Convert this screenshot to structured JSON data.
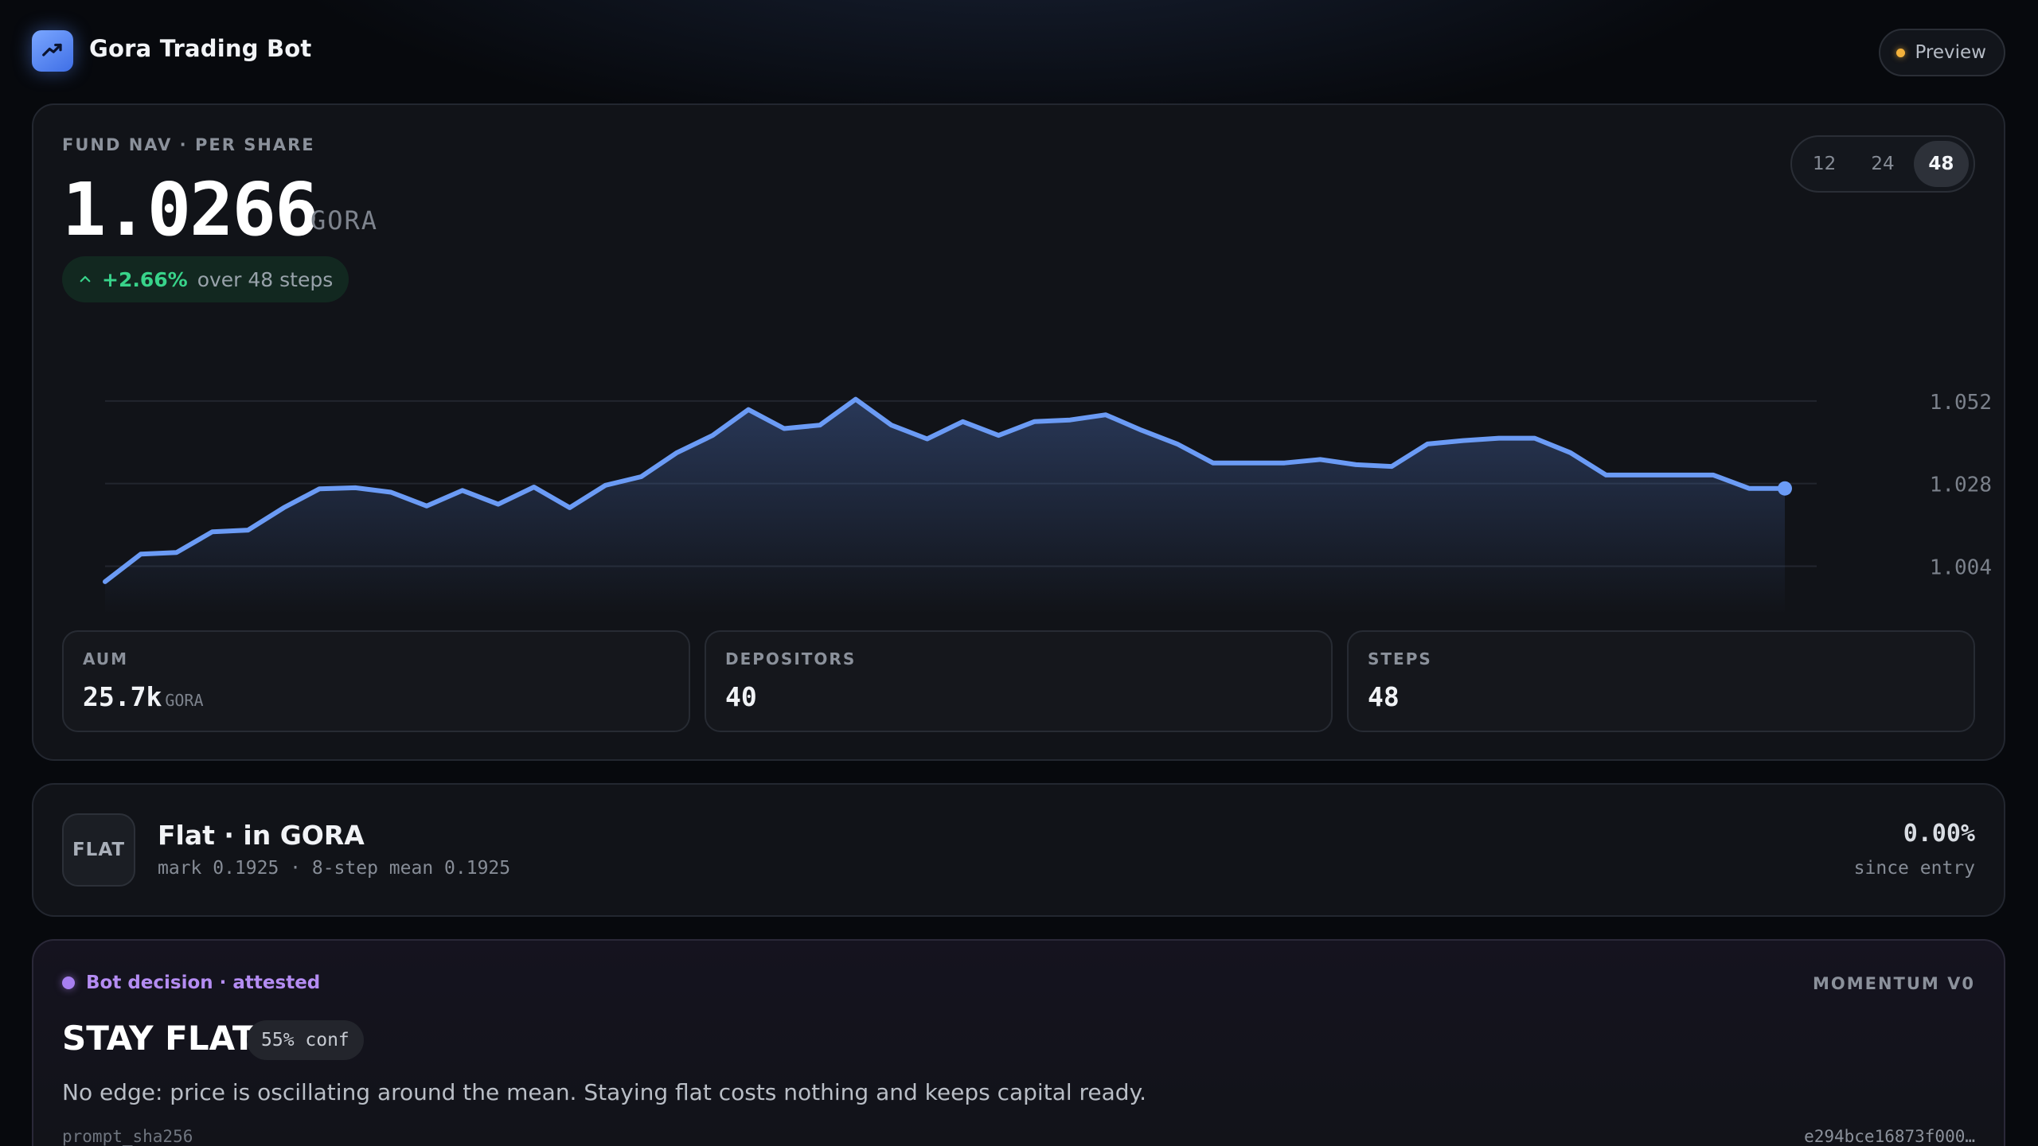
{
  "app": {
    "title": "Gora Trading Bot",
    "preview_label": "Preview"
  },
  "nav": {
    "kicker": "FUND NAV · PER SHARE",
    "value": "1.0266",
    "unit": "GORA",
    "change_pct": "+2.66%",
    "change_text": "over 48 steps"
  },
  "range_options": [
    "12",
    "24",
    "48"
  ],
  "range_selected": "48",
  "stats": [
    {
      "label": "AUM",
      "value": "25.7k",
      "unit": "GORA"
    },
    {
      "label": "DEPOSITORS",
      "value": "40",
      "unit": ""
    },
    {
      "label": "STEPS",
      "value": "48",
      "unit": ""
    }
  ],
  "position": {
    "badge": "FLAT",
    "title": "Flat · in GORA",
    "subtitle": "mark 0.1925 · 8-step mean 0.1925",
    "pnl": "0.00%",
    "pnl_label": "since entry"
  },
  "bot": {
    "tag": "Bot decision · attested",
    "model": "MOMENTUM V0",
    "decision": "STAY FLAT",
    "confidence": "55% conf",
    "reason": "No edge: price is oscillating around the mean. Staying flat costs nothing and keeps capital ready.",
    "hash_label": "prompt_sha256",
    "hash_value": "e294bce16873f000…"
  },
  "colors": {
    "accent": "#6b9bf5",
    "positive": "#38d38a",
    "bot_accent": "#b48cf2",
    "preview_dot": "#f4b23c"
  },
  "icons": {
    "logo": "trend-chart-icon",
    "change": "chevron-up-icon"
  },
  "chart_data": {
    "type": "area",
    "title": "",
    "xlabel": "",
    "ylabel": "",
    "x": [
      1,
      2,
      3,
      4,
      5,
      6,
      7,
      8,
      9,
      10,
      11,
      12,
      13,
      14,
      15,
      16,
      17,
      18,
      19,
      20,
      21,
      22,
      23,
      24,
      25,
      26,
      27,
      28,
      29,
      30,
      31,
      32,
      33,
      34,
      35,
      36,
      37,
      38,
      39,
      40,
      41,
      42,
      43,
      44,
      45,
      46,
      47,
      48
    ],
    "series": [
      {
        "values": [
          0.9995,
          1.0075,
          1.008,
          1.014,
          1.0145,
          1.021,
          1.0265,
          1.0268,
          1.0255,
          1.0215,
          1.026,
          1.022,
          1.027,
          1.021,
          1.0275,
          1.03,
          1.037,
          1.042,
          1.0495,
          1.044,
          1.045,
          1.0525,
          1.045,
          1.041,
          1.046,
          1.042,
          1.046,
          1.0465,
          1.048,
          1.0435,
          1.0395,
          1.034,
          1.034,
          1.034,
          1.035,
          1.0335,
          1.033,
          1.0395,
          1.0405,
          1.0412,
          1.0412,
          1.037,
          1.0305,
          1.0305,
          1.0305,
          1.0305,
          1.0266,
          1.0266
        ]
      }
    ],
    "y_ticks": [
      "1.052",
      "1.028",
      "1.004"
    ],
    "y_tick_values": [
      1.052,
      1.028,
      1.004
    ],
    "ylim": [
      0.99,
      1.064
    ],
    "grid": true,
    "legend": "none"
  }
}
